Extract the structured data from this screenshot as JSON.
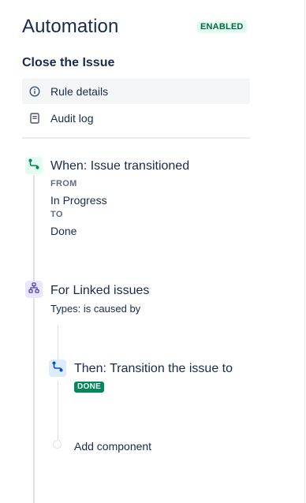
{
  "header": {
    "title": "Automation",
    "status": "ENABLED"
  },
  "rule": {
    "name": "Close the Issue"
  },
  "nav": {
    "items": [
      {
        "label": "Rule details",
        "icon": "info-icon",
        "selected": true
      },
      {
        "label": "Audit log",
        "icon": "document-icon",
        "selected": false
      }
    ]
  },
  "flow": {
    "trigger": {
      "title": "When: Issue transitioned",
      "from_label": "FROM",
      "from_value": "In Progress",
      "to_label": "TO",
      "to_value": "Done",
      "icon": "transition-icon"
    },
    "branch": {
      "title": "For Linked issues",
      "subtitle": "Types: is caused by",
      "icon": "hierarchy-icon"
    },
    "action": {
      "title": "Then: Transition the issue to",
      "status": "DONE",
      "icon": "transition-icon"
    },
    "add_component": {
      "label": "Add component"
    }
  },
  "colors": {
    "text": "#172b4d",
    "enabled_bg": "#e3fcef",
    "enabled_text": "#006644",
    "done_bg": "#00875a",
    "trigger_icon_bg": "#e3fcef",
    "trigger_icon_color": "#00875a",
    "branch_icon_bg": "#eae6ff",
    "branch_icon_color": "#5243aa",
    "action_icon_bg": "#deebff",
    "action_icon_color": "#0052cc",
    "line": "#dfe1e6"
  }
}
